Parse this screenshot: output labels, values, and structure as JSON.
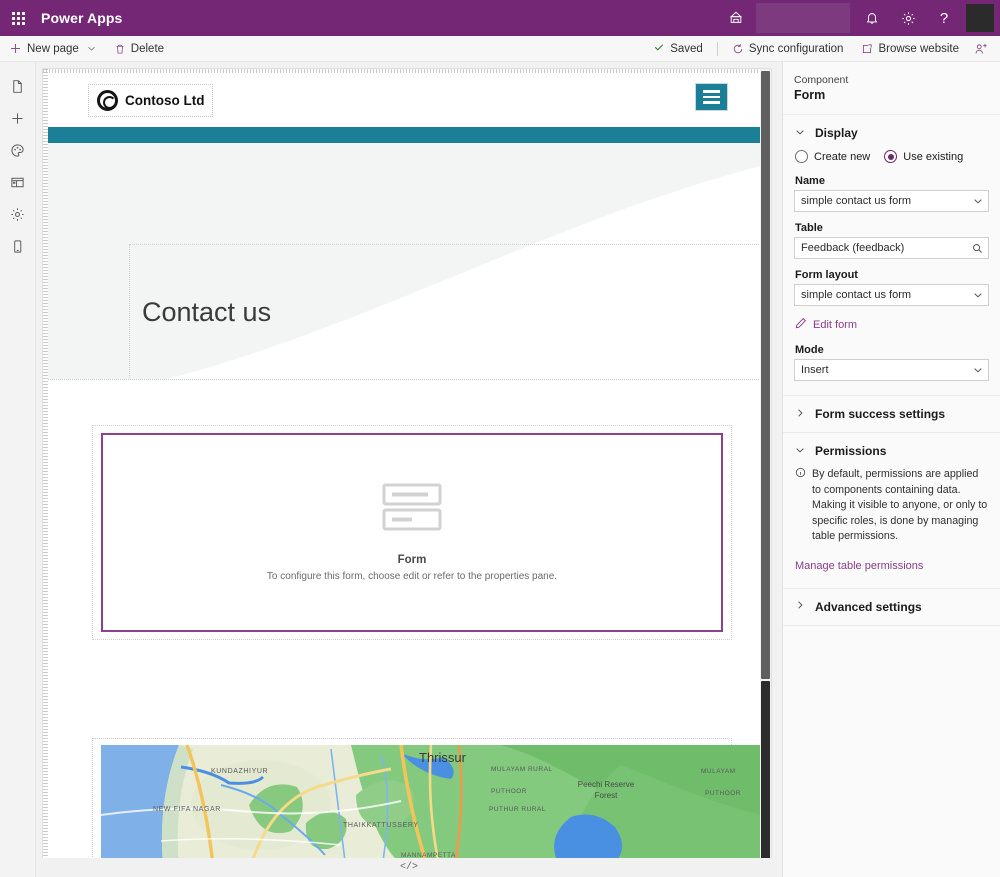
{
  "suite": {
    "waffle_label": "app-launcher",
    "title": "Power Apps",
    "icons": {
      "environment": "environment-icon",
      "notifications": "bell-icon",
      "settings": "gear-icon",
      "help": "question-icon",
      "avatar": "user-avatar"
    }
  },
  "command_bar": {
    "new_page": "New page",
    "delete": "Delete",
    "saved": "Saved",
    "sync_configuration": "Sync configuration",
    "browse_website": "Browse website",
    "share": "share-icon"
  },
  "rail": {
    "items": [
      {
        "name": "pages",
        "icon": "page-icon"
      },
      {
        "name": "add",
        "icon": "plus-icon"
      },
      {
        "name": "theme",
        "icon": "palette-icon"
      },
      {
        "name": "components",
        "icon": "components-icon"
      },
      {
        "name": "settings",
        "icon": "gear-icon"
      },
      {
        "name": "devices",
        "icon": "mobile-icon"
      }
    ]
  },
  "canvas": {
    "site": {
      "logo_text": "Contoso Ltd",
      "logo_icon": "contoso-spiral-logo",
      "menu_icon": "hamburger-menu-icon",
      "nav_color": "#1a7f97"
    },
    "hero": {
      "title": "Contact us"
    },
    "form_placeholder": {
      "icon": "form-fields-icon",
      "title": "Form",
      "subtitle": "To configure this form, choose edit or refer to the properties pane.",
      "selected_border_color": "#8f3f8f"
    },
    "map": {
      "labels": [
        "Thrissur",
        "KUNDAZHIYUR",
        "NEW FIFA NAGAR",
        "MULAYAM RURAL",
        "PUTHOOR",
        "PUTHUR RURAL",
        "THAIKKATTUSSERY",
        "MANNAMPETTA",
        "Peechi Reserve Forest"
      ]
    },
    "code_button": "</>"
  },
  "properties": {
    "kicker": "Component",
    "title": "Form",
    "display": {
      "section_title": "Display",
      "expanded": true,
      "source_options": [
        {
          "label": "Create new",
          "selected": false
        },
        {
          "label": "Use existing",
          "selected": true
        }
      ],
      "name_label": "Name",
      "name_value": "simple contact us form",
      "table_label": "Table",
      "table_value": "Feedback (feedback)",
      "form_layout_label": "Form layout",
      "form_layout_value": "simple contact us form",
      "edit_form_link": "Edit form",
      "mode_label": "Mode",
      "mode_value": "Insert"
    },
    "form_success": {
      "section_title": "Form success settings",
      "expanded": false
    },
    "permissions": {
      "section_title": "Permissions",
      "expanded": true,
      "info": "By default, permissions are applied to components containing data. Making it visible to anyone, or only to specific roles, is done by managing table permissions.",
      "link": "Manage table permissions"
    },
    "advanced": {
      "section_title": "Advanced settings",
      "expanded": false
    }
  },
  "colors": {
    "brand_purple": "#742774",
    "accent_teal": "#1a7f97",
    "link_purple": "#8a3d8a",
    "selection_purple": "#8f3f8f"
  }
}
